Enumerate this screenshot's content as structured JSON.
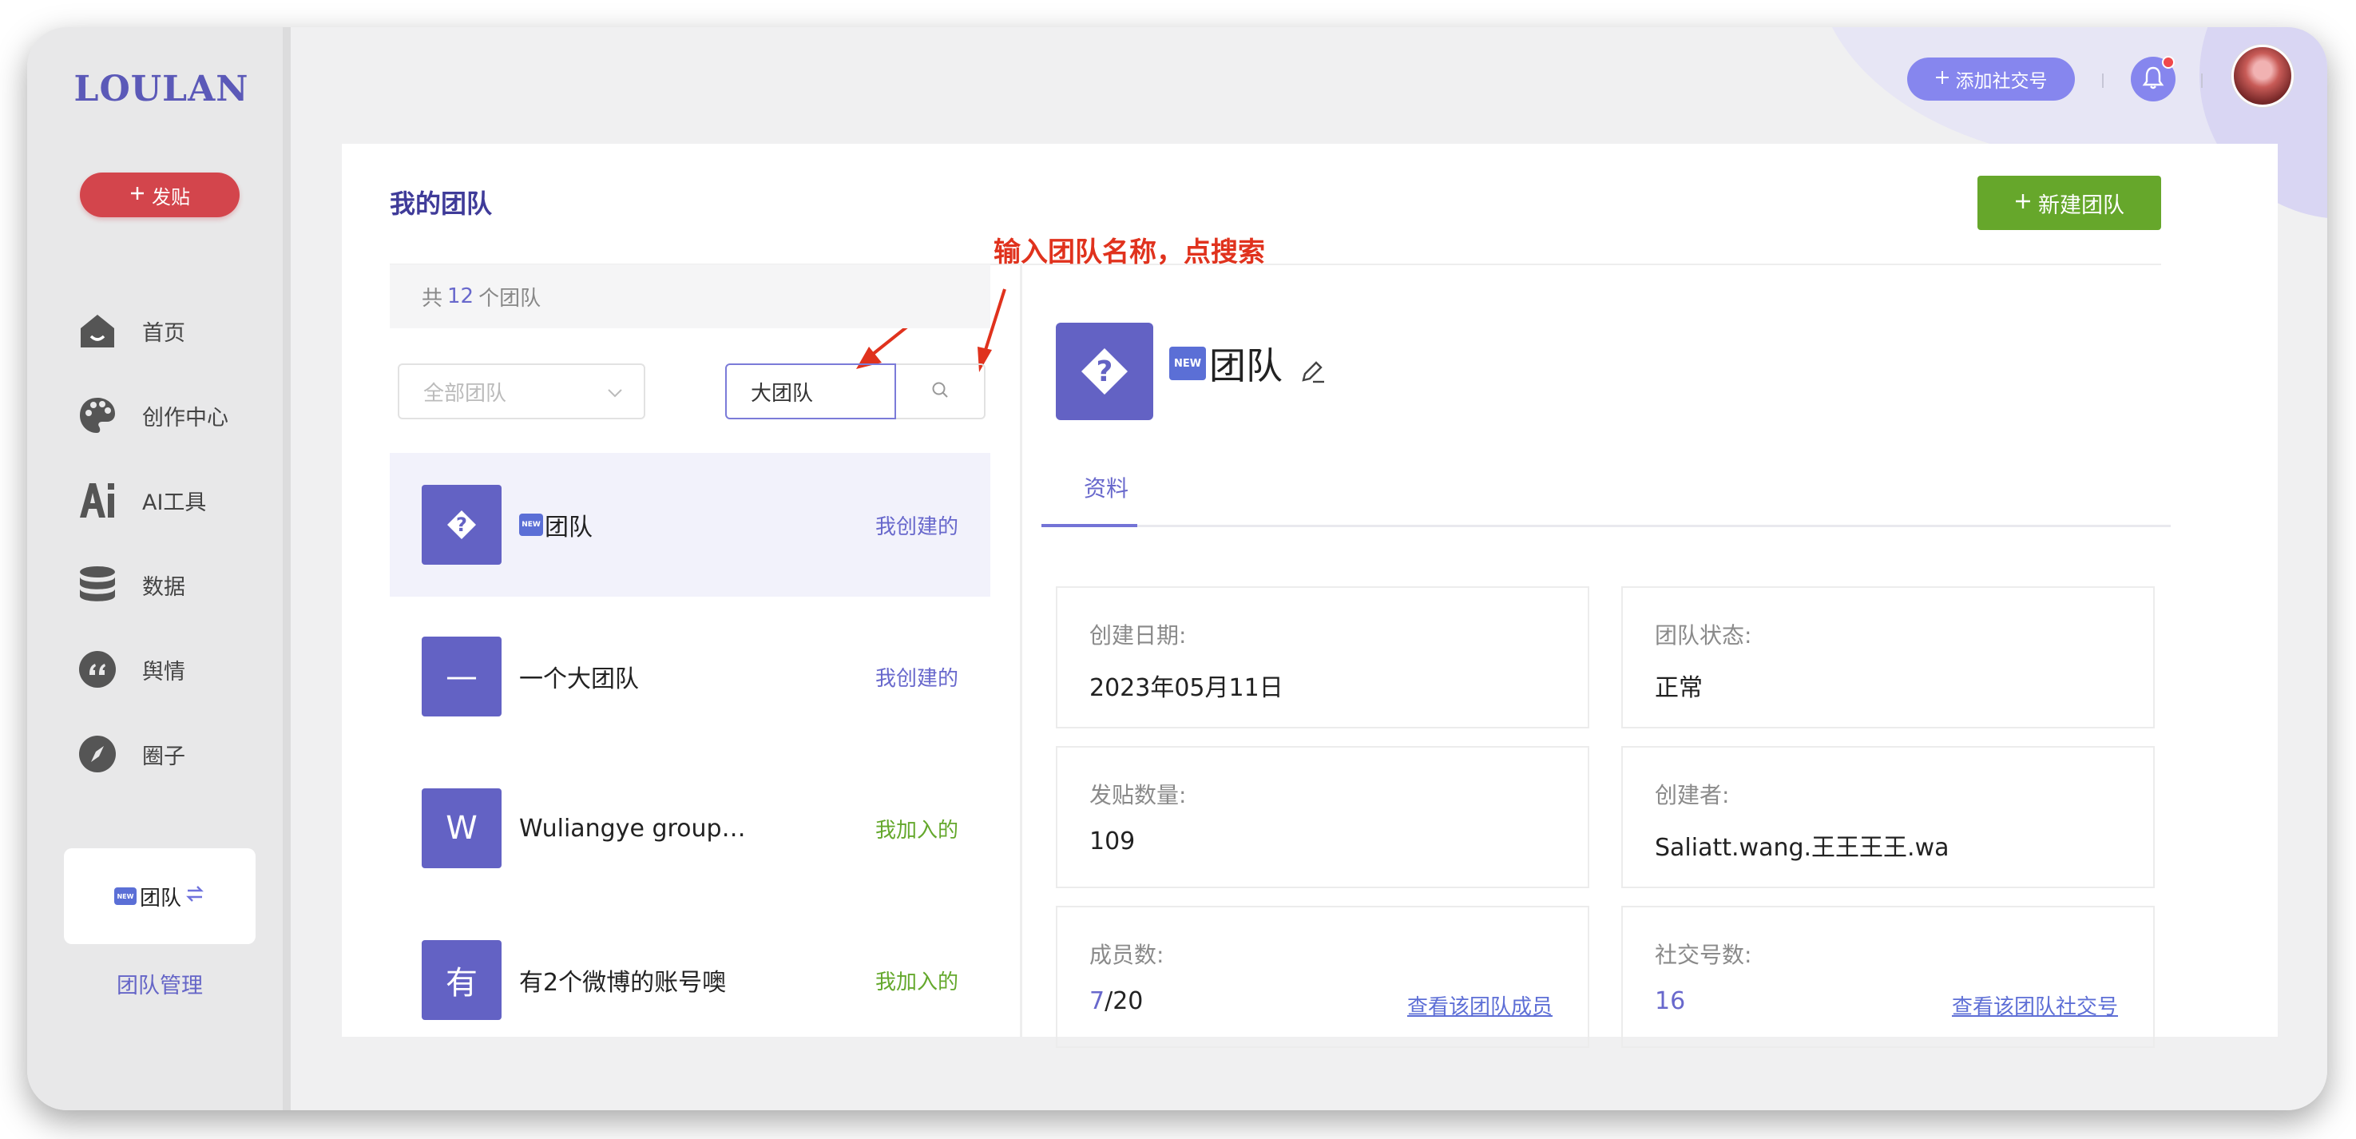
{
  "brand": {
    "logo": "LOULAN",
    "accent": "#5b59b8"
  },
  "sidebar": {
    "post_button": "发贴",
    "items": [
      {
        "label": "首页",
        "icon": "home-icon"
      },
      {
        "label": "创作中心",
        "icon": "palette-icon"
      },
      {
        "label": "AI工具",
        "icon": "ai-icon"
      },
      {
        "label": "数据",
        "icon": "database-icon"
      },
      {
        "label": "舆情",
        "icon": "quote-icon"
      },
      {
        "label": "圈子",
        "icon": "compass-icon"
      }
    ],
    "team_card": {
      "badge": "NEW",
      "label": "团队"
    },
    "team_manage": "团队管理"
  },
  "header": {
    "add_social": "添加社交号"
  },
  "page": {
    "title": "我的团队",
    "new_team_button": "新建团队",
    "annotation": "输入团队名称，点搜索"
  },
  "list": {
    "count_prefix": "共",
    "count": "12",
    "count_suffix": "个团队",
    "filter_placeholder": "全部团队",
    "search_value": "大团队",
    "teams": [
      {
        "avatar": "?",
        "badge": "NEW",
        "name": "团队",
        "role": "我创建的"
      },
      {
        "avatar": "—",
        "name": "一个大团队",
        "role": "我创建的"
      },
      {
        "avatar": "W",
        "name": "Wuliangye group…",
        "role": "我加入的"
      },
      {
        "avatar": "有",
        "name": "有2个微博的账号噢",
        "role": "我加入的"
      }
    ]
  },
  "detail": {
    "badge": "NEW",
    "name": "团队",
    "tab": "资料",
    "created_date_label": "创建日期:",
    "created_date": "2023年05月11日",
    "status_label": "团队状态:",
    "status": "正常",
    "post_count_label": "发贴数量:",
    "post_count": "109",
    "creator_label": "创建者:",
    "creator": "Saliatt.wang.王王王王.wa",
    "members_label": "成员数:",
    "members_current": "7",
    "members_total": "/20",
    "members_link": "查看该团队成员",
    "social_label": "社交号数:",
    "social_count": "16",
    "social_link": "查看该团队社交号"
  }
}
